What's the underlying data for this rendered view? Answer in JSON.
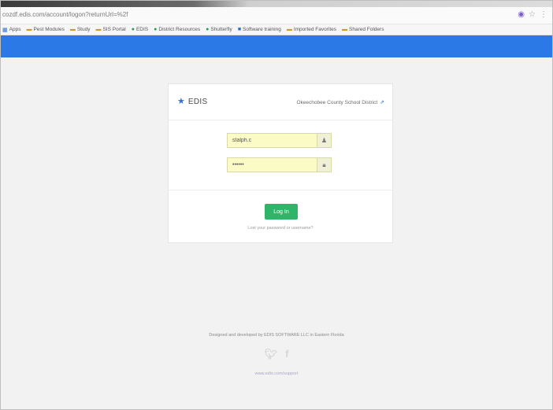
{
  "browser": {
    "url": "cozdf.edis.com/account/logon?returnUrl=%2f",
    "icons": [
      "extension-icon",
      "star-icon",
      "menu-icon"
    ],
    "bookmarks": [
      {
        "label": "Apps",
        "icon": "apps-icon"
      },
      {
        "label": "Pest Modules",
        "icon": "folder-icon"
      },
      {
        "label": "Study",
        "icon": "folder-icon"
      },
      {
        "label": "SIS Portal",
        "icon": "folder-icon"
      },
      {
        "label": "EDIS",
        "icon": "page-icon"
      },
      {
        "label": "District Resources",
        "icon": "page-icon"
      },
      {
        "label": "Shutterfly",
        "icon": "page-icon"
      },
      {
        "label": "Software training",
        "icon": "page-icon"
      },
      {
        "label": "Imported Favorites",
        "icon": "folder-icon"
      },
      {
        "label": "Shared Folders",
        "icon": "folder-icon"
      }
    ]
  },
  "login": {
    "brand": "EDIS",
    "district": "Okeechobee County School District",
    "username_value": "stalph.c",
    "password_value": "••••••",
    "button_label": "Log In",
    "forgot_text": "Lost your password or username?"
  },
  "footer": {
    "credit": "Designed and developed by EDIS SOFTWARE LLC in Eastern Florida",
    "link": "www.edis.com/support"
  },
  "colors": {
    "accent_bar": "#2a79e6",
    "login_button": "#2fb56a",
    "input_autofill": "#fbfbc6",
    "brand_star": "#3a6fd8"
  }
}
